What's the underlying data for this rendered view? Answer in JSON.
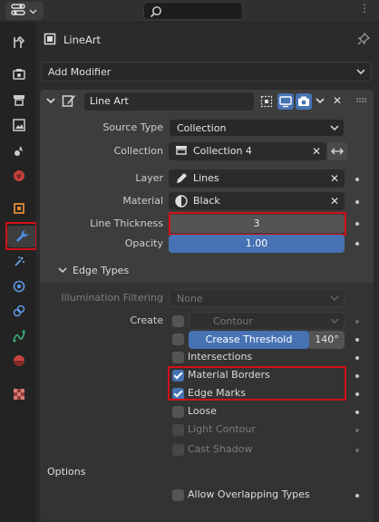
{
  "header": {
    "search_placeholder": ""
  },
  "object": {
    "name": "LineArt"
  },
  "add_modifier": {
    "label": "Add Modifier"
  },
  "modifier": {
    "name": "Line Art",
    "source_type": {
      "label": "Source Type",
      "value": "Collection"
    },
    "collection": {
      "label": "Collection",
      "value": "Collection 4"
    },
    "layer": {
      "label": "Layer",
      "value": "Lines"
    },
    "material": {
      "label": "Material",
      "value": "Black"
    },
    "line_thickness": {
      "label": "Line Thickness",
      "value": "3"
    },
    "opacity": {
      "label": "Opacity",
      "value": "1.00",
      "fraction": 1.0
    }
  },
  "edge_types": {
    "title": "Edge Types",
    "illumination": {
      "label": "Illumination Filtering",
      "value": "None"
    },
    "create_label": "Create",
    "contour": {
      "label": "Contour",
      "checked": false
    },
    "crease": {
      "label": "Crease Threshold",
      "value": "140°",
      "checked": false
    },
    "intersections": {
      "label": "Intersections",
      "checked": false
    },
    "material_borders": {
      "label": "Material Borders",
      "checked": true
    },
    "edge_marks": {
      "label": "Edge Marks",
      "checked": true
    },
    "loose": {
      "label": "Loose",
      "checked": false
    },
    "light_contour": {
      "label": "Light Contour",
      "checked": false
    },
    "cast_shadow": {
      "label": "Cast Shadow",
      "checked": false
    }
  },
  "options": {
    "title": "Options",
    "allow_overlapping": {
      "label": "Allow Overlapping Types",
      "checked": false
    }
  },
  "colors": {
    "accent": "#4772b3",
    "highlight": "#d0101a"
  }
}
